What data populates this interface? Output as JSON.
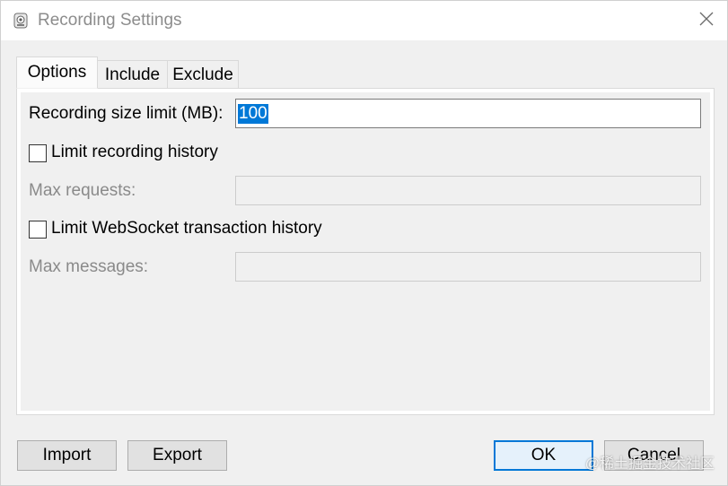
{
  "window": {
    "title": "Recording Settings",
    "app_icon": "fiddler-app-icon",
    "close_icon": "close-icon"
  },
  "tabs": [
    {
      "label": "Options",
      "active": true
    },
    {
      "label": "Include",
      "active": false
    },
    {
      "label": "Exclude",
      "active": false
    }
  ],
  "options": {
    "size_limit_label": "Recording size limit (MB):",
    "size_limit_value": "100",
    "limit_history_label": "Limit recording history",
    "limit_history_checked": false,
    "max_requests_label": "Max requests:",
    "max_requests_value": "",
    "limit_ws_label": "Limit WebSocket transaction history",
    "limit_ws_checked": false,
    "max_messages_label": "Max messages:",
    "max_messages_value": ""
  },
  "buttons": {
    "import": "Import",
    "export": "Export",
    "ok": "OK",
    "cancel": "Cancel"
  },
  "watermark": "@稀土掘金技术社区",
  "colors": {
    "selection": "#0078d7",
    "window_bg": "#f0f0f0",
    "default_button_border": "#0078d7"
  }
}
